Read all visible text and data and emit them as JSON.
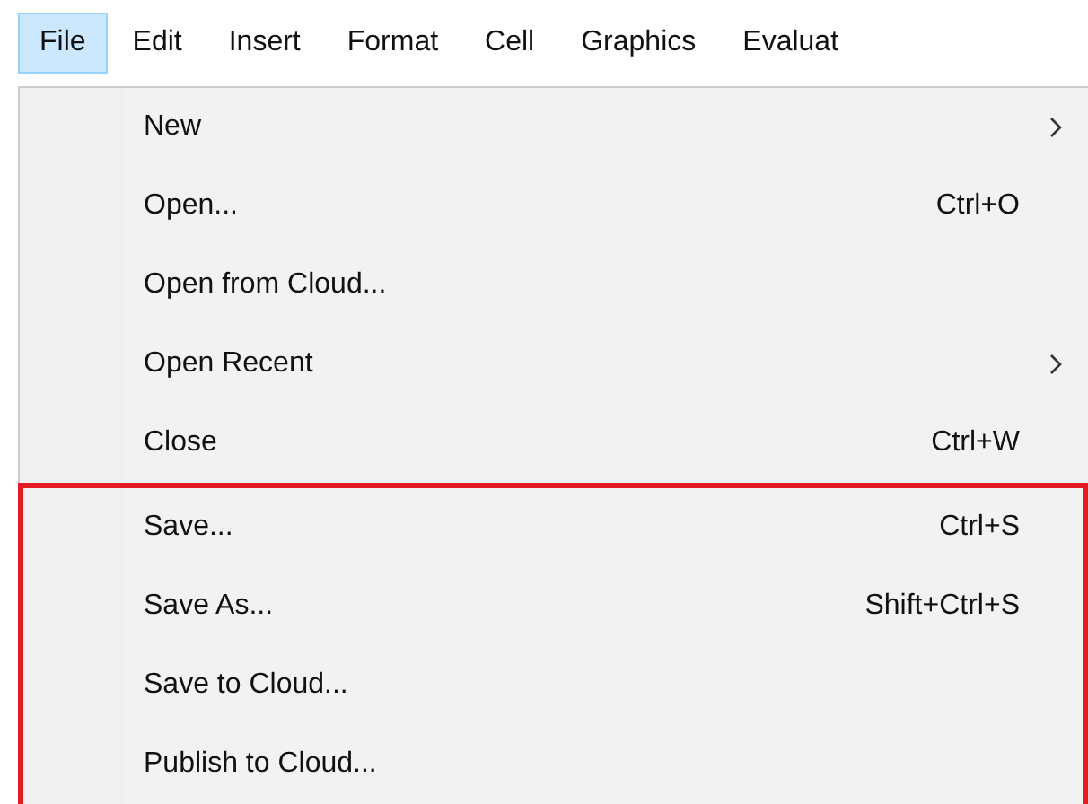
{
  "menubar": [
    {
      "label": "File",
      "selected": true
    },
    {
      "label": "Edit",
      "selected": false
    },
    {
      "label": "Insert",
      "selected": false
    },
    {
      "label": "Format",
      "selected": false
    },
    {
      "label": "Cell",
      "selected": false
    },
    {
      "label": "Graphics",
      "selected": false
    },
    {
      "label": "Evaluat",
      "selected": false
    }
  ],
  "menu": {
    "items": [
      {
        "label": "New",
        "submenu": true,
        "highlighted": false
      },
      {
        "label": "Open...",
        "shortcut": "Ctrl+O",
        "submenu": false,
        "highlighted": false
      },
      {
        "label": "Open from Cloud...",
        "submenu": false,
        "highlighted": false
      },
      {
        "label": "Open Recent",
        "submenu": true,
        "highlighted": false
      },
      {
        "label": "Close",
        "shortcut": "Ctrl+W",
        "submenu": false,
        "highlighted": false
      },
      {
        "label": "Save...",
        "shortcut": "Ctrl+S",
        "submenu": false,
        "highlighted": true
      },
      {
        "label": "Save As...",
        "shortcut": "Shift+Ctrl+S",
        "submenu": false,
        "highlighted": true
      },
      {
        "label": "Save to Cloud...",
        "submenu": false,
        "highlighted": true
      },
      {
        "label": "Publish to Cloud...",
        "submenu": false,
        "highlighted": true
      }
    ]
  }
}
